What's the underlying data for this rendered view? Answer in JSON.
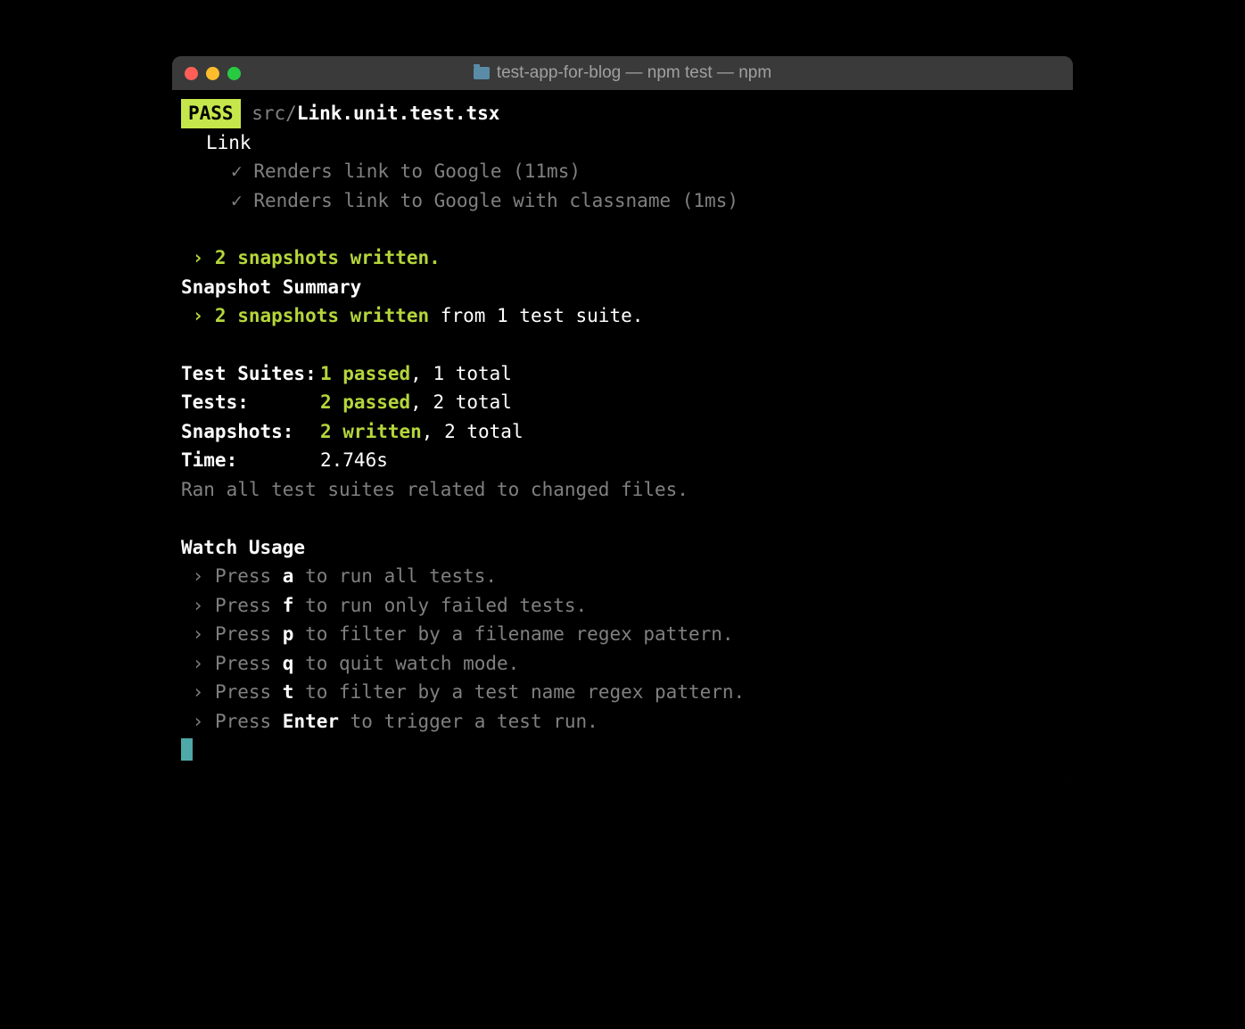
{
  "window": {
    "title": "test-app-for-blog — npm test — npm"
  },
  "test_run": {
    "badge": "PASS",
    "path_prefix": "src/",
    "file": "Link.unit.test.tsx",
    "describe_block": "Link",
    "tests": [
      {
        "check": "✓",
        "name": "Renders link to Google",
        "time": "(11ms)"
      },
      {
        "check": "✓",
        "name": "Renders link to Google with classname",
        "time": "(1ms)"
      }
    ]
  },
  "snapshots": {
    "written_line": " › 2 snapshots written.",
    "summary_header": "Snapshot Summary",
    "summary_prefix": " › 2 snapshots written",
    "summary_suffix": " from 1 test suite."
  },
  "stats": {
    "suites_label": "Test Suites:",
    "suites_pass": "1 passed",
    "suites_rest": ", 1 total",
    "tests_label": "Tests:",
    "tests_pass": "2 passed",
    "tests_rest": ", 2 total",
    "snaps_label": "Snapshots:",
    "snaps_pass": "2 written",
    "snaps_rest": ", 2 total",
    "time_label": "Time:",
    "time_value": "2.746s",
    "ran_note": "Ran all test suites related to changed files."
  },
  "watch": {
    "header": "Watch Usage",
    "arrow": " › ",
    "press": "Press ",
    "items": [
      {
        "key": "a",
        "desc": " to run all tests."
      },
      {
        "key": "f",
        "desc": " to run only failed tests."
      },
      {
        "key": "p",
        "desc": " to filter by a filename regex pattern."
      },
      {
        "key": "q",
        "desc": " to quit watch mode."
      },
      {
        "key": "t",
        "desc": " to filter by a test name regex pattern."
      },
      {
        "key": "Enter",
        "desc": " to trigger a test run."
      }
    ]
  }
}
